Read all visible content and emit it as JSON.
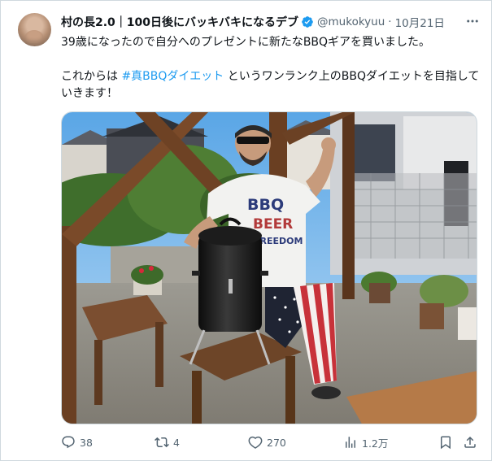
{
  "post": {
    "author_name": "村の長2.0｜100日後にバッキバキになるデブ",
    "handle": "@mukokyuu",
    "separator": "·",
    "time": "10月21日",
    "text_line1": "39歳になったので自分へのプレゼントに新たなBBQギアを買いました。",
    "text_line2_prefix": "これからは ",
    "hashtag": "#真BBQダイエット",
    "text_line2_suffix": " というワンランク上のBBQダイエットを目指していきます！",
    "shirt_word1": "BBQ",
    "shirt_word2": "BEER",
    "shirt_word3": "FREEDOM"
  },
  "actions": {
    "replies": "38",
    "reposts": "4",
    "likes": "270",
    "views": "1.2万"
  },
  "icons": {
    "verified": "verified-badge-icon",
    "more": "more-dots-icon",
    "reply": "reply-bubble-icon",
    "repost": "repost-arrows-icon",
    "like": "heart-icon",
    "views": "views-bar-chart-icon",
    "bookmark": "bookmark-icon",
    "share": "share-upload-icon"
  },
  "colors": {
    "accent": "#1d9bf0",
    "text": "#0f1419",
    "muted": "#536471",
    "border": "#cfd9de"
  }
}
